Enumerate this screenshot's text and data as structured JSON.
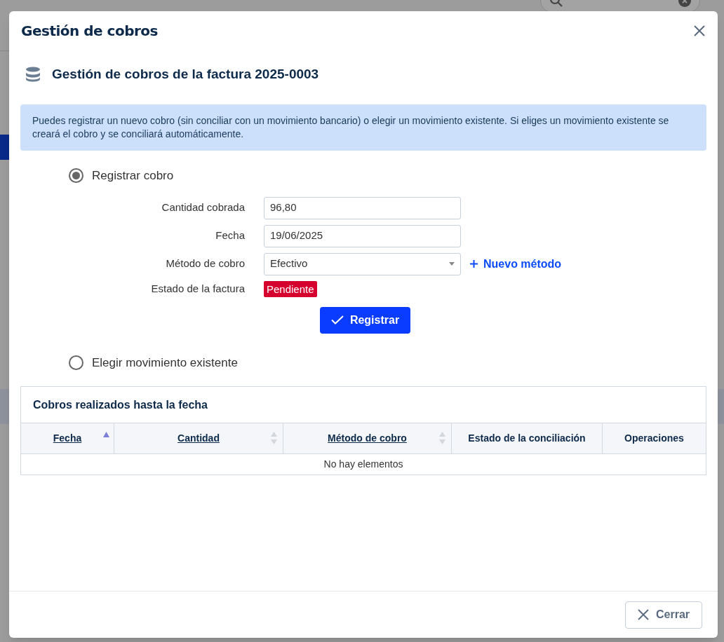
{
  "dialog": {
    "title": "Gestión de cobros",
    "section_title": "Gestión de cobros de la factura 2025-0003",
    "info": "Puedes registrar un nuevo cobro (sin conciliar con un movimiento bancario) o elegir un movimiento existente. Si eliges un movimiento existente se creará el cobro y se conciliará automáticamente.",
    "options": [
      {
        "label": "Registrar cobro",
        "selected": true
      },
      {
        "label": "Elegir movimiento existente",
        "selected": false
      }
    ],
    "form": {
      "amount": {
        "label": "Cantidad cobrada",
        "value": "96,80"
      },
      "date": {
        "label": "Fecha",
        "value": "19/06/2025"
      },
      "method": {
        "label": "Método de cobro",
        "value": "Efectivo",
        "link": "Nuevo método"
      },
      "status": {
        "label": "Estado de la factura",
        "value": "Pendiente",
        "color": "#d6002f"
      },
      "submit": "Registrar"
    },
    "table": {
      "title": "Cobros realizados hasta la fecha",
      "columns": [
        {
          "label": "Fecha",
          "sortable": true,
          "sorted": true
        },
        {
          "label": "Cantidad",
          "sortable": true,
          "sorted": false
        },
        {
          "label": "Método de cobro",
          "sortable": true,
          "sorted": false
        },
        {
          "label": "Estado de la conciliación",
          "sortable": false
        },
        {
          "label": "Operaciones",
          "sortable": false
        }
      ],
      "empty": "No hay elementos"
    },
    "buttons": [
      {
        "label": "Cerrar"
      }
    ]
  }
}
